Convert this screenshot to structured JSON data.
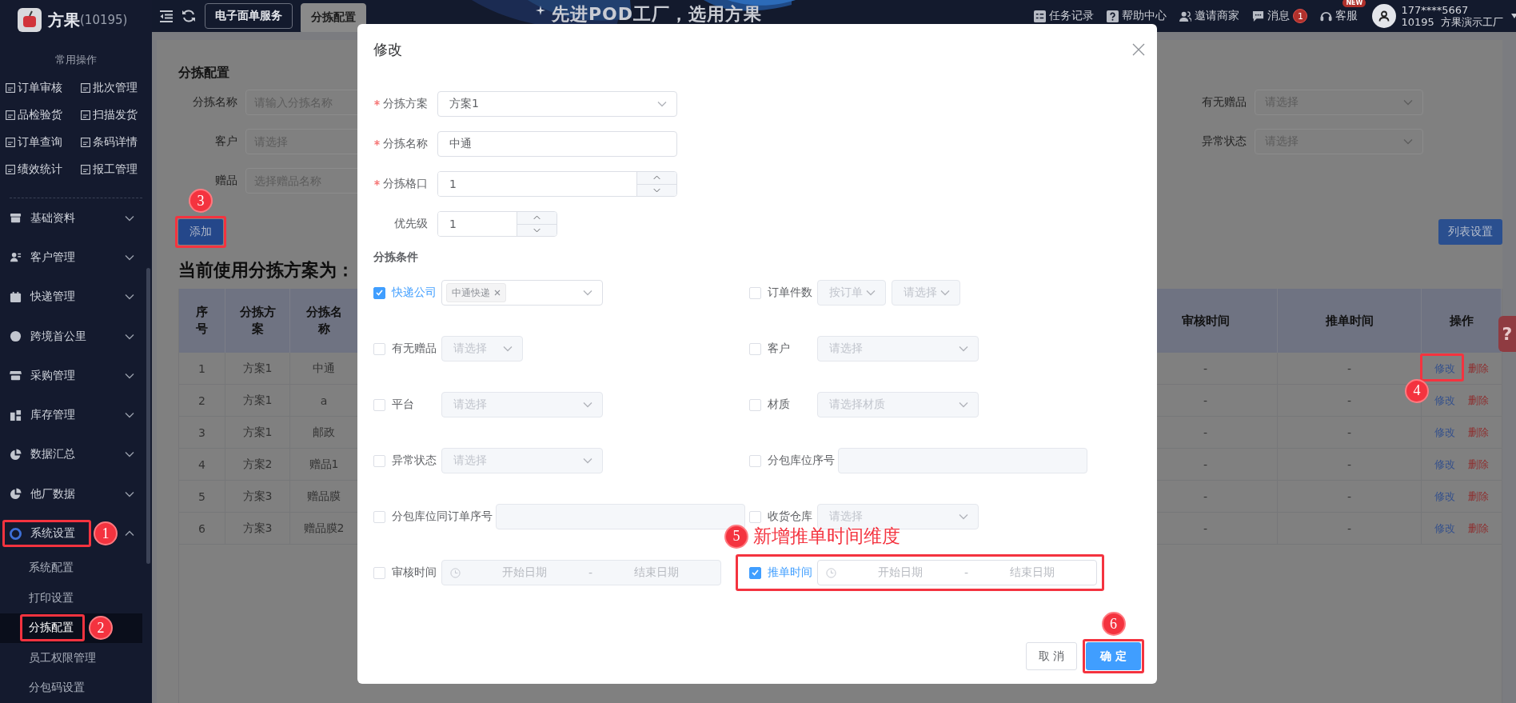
{
  "sidebar": {
    "logo_text": "方果",
    "logo_count": "(10195)",
    "quick_title": "常用操作",
    "quick_actions": [
      {
        "label": "订单审核"
      },
      {
        "label": "批次管理"
      },
      {
        "label": "品检验货"
      },
      {
        "label": "扫描发货"
      },
      {
        "label": "订单查询"
      },
      {
        "label": "条码详情"
      },
      {
        "label": "绩效统计"
      },
      {
        "label": "报工管理"
      }
    ],
    "menu": [
      {
        "label": "基础资料",
        "expanded": false
      },
      {
        "label": "客户管理",
        "expanded": false
      },
      {
        "label": "快递管理",
        "expanded": false
      },
      {
        "label": "跨境首公里",
        "expanded": false
      },
      {
        "label": "采购管理",
        "expanded": false
      },
      {
        "label": "库存管理",
        "expanded": false
      },
      {
        "label": "数据汇总",
        "expanded": false
      },
      {
        "label": "他厂数据",
        "expanded": false
      },
      {
        "label": "系统设置",
        "expanded": true,
        "callout": "1",
        "children": [
          {
            "label": "系统配置",
            "selected": false
          },
          {
            "label": "打印设置",
            "selected": false
          },
          {
            "label": "分拣配置",
            "selected": true,
            "callout": "2"
          },
          {
            "label": "员工权限管理",
            "selected": false
          },
          {
            "label": "分包码设置",
            "selected": false
          }
        ]
      }
    ]
  },
  "header": {
    "tabs": [
      {
        "label": "电子面单服务",
        "selected": false
      },
      {
        "label": "分拣配置",
        "selected": true
      }
    ],
    "banner": "先进POD工厂，选用方果",
    "links": [
      {
        "label": "任务记录"
      },
      {
        "label": "帮助中心"
      },
      {
        "label": "邀请商家"
      },
      {
        "label": "消息",
        "count": "1"
      },
      {
        "label": "客服",
        "badge": "NEW"
      }
    ],
    "user": {
      "phone": "177****5667",
      "company": "10195  方果演示工厂"
    }
  },
  "page": {
    "title": "分拣配置",
    "filters_left": [
      {
        "label": "分拣名称",
        "placeholder": "请输入分拣名称"
      },
      {
        "label": "客户",
        "placeholder": "请选择"
      },
      {
        "label": "赠品",
        "placeholder": "选择赠品名称"
      }
    ],
    "filters_right": [
      {
        "label": "有无赠品",
        "placeholder": "请选择"
      },
      {
        "label": "异常状态",
        "placeholder": "请选择"
      }
    ],
    "add_button": {
      "label": "添加",
      "callout": "3"
    },
    "list_settings_button": "列表设置",
    "heading": "当前使用分拣方案为：",
    "table": {
      "columns": [
        "序号",
        "分拣方案",
        "分拣名称",
        "审核时间",
        "推单时间",
        "操作"
      ],
      "rows": [
        {
          "cells": [
            "1",
            "方案1",
            "中通",
            "-",
            "-"
          ],
          "actions": [
            {
              "label": "修改",
              "kind": "edit",
              "callout": "4"
            },
            {
              "label": "删除",
              "kind": "delete"
            }
          ]
        },
        {
          "cells": [
            "2",
            "方案1",
            "a",
            "-",
            "-"
          ],
          "actions": [
            {
              "label": "修改",
              "kind": "edit"
            },
            {
              "label": "删除",
              "kind": "delete"
            }
          ]
        },
        {
          "cells": [
            "3",
            "方案1",
            "邮政",
            "-",
            "-"
          ],
          "actions": [
            {
              "label": "修改",
              "kind": "edit"
            },
            {
              "label": "删除",
              "kind": "delete"
            }
          ]
        },
        {
          "cells": [
            "4",
            "方案2",
            "赠品1",
            "-",
            "-"
          ],
          "actions": [
            {
              "label": "修改",
              "kind": "edit"
            },
            {
              "label": "删除",
              "kind": "delete"
            }
          ]
        },
        {
          "cells": [
            "5",
            "方案3",
            "赠品膜",
            "-",
            "-"
          ],
          "actions": [
            {
              "label": "修改",
              "kind": "edit"
            },
            {
              "label": "删除",
              "kind": "delete"
            }
          ]
        },
        {
          "cells": [
            "6",
            "方案3",
            "赠品膜2",
            "-",
            "-"
          ],
          "actions": [
            {
              "label": "修改",
              "kind": "edit"
            },
            {
              "label": "删除",
              "kind": "delete"
            }
          ]
        }
      ]
    },
    "help_tab": "?"
  },
  "modal": {
    "title": "修改",
    "fields": [
      {
        "label": "分拣方案",
        "required": true,
        "kind": "select",
        "value": "方案1"
      },
      {
        "label": "分拣名称",
        "required": true,
        "kind": "input",
        "value": "中通"
      },
      {
        "label": "分拣格口",
        "required": true,
        "kind": "number",
        "value": "1"
      },
      {
        "label": "优先级",
        "required": false,
        "kind": "number_short",
        "value": "1"
      }
    ],
    "conditions_title": "分拣条件",
    "conditions": [
      {
        "label": "快递公司",
        "checked": true,
        "kind": "tags",
        "tags": [
          "中通快递"
        ]
      },
      {
        "label": "订单件数",
        "checked": false,
        "kind": "selects",
        "selects": [
          {
            "placeholder": "按订单"
          },
          {
            "placeholder": "请选择"
          }
        ]
      },
      {
        "label": "有无赠品",
        "checked": false,
        "kind": "short_select",
        "placeholder": "请选择"
      },
      {
        "label": "客户",
        "checked": false,
        "kind": "select",
        "placeholder": "请选择"
      },
      {
        "label": "平台",
        "checked": false,
        "kind": "select",
        "placeholder": "请选择"
      },
      {
        "label": "材质",
        "checked": false,
        "kind": "select",
        "placeholder": "请选择材质"
      },
      {
        "label": "异常状态",
        "checked": false,
        "kind": "select",
        "placeholder": "请选择"
      },
      {
        "label": "分包库位序号",
        "checked": false,
        "kind": "input"
      },
      {
        "label": "分包库位同订单序号",
        "checked": false,
        "kind": "input"
      },
      {
        "label": "收货仓库",
        "checked": false,
        "kind": "select",
        "placeholder": "请选择"
      },
      {
        "label": "审核时间",
        "checked": false,
        "kind": "date_range",
        "start_placeholder": "开始日期",
        "separator": "-",
        "end_placeholder": "结束日期"
      },
      {
        "label": "推单时间",
        "checked": true,
        "kind": "date_range",
        "start_placeholder": "开始日期",
        "separator": "-",
        "end_placeholder": "结束日期",
        "callout": "5",
        "callout_text": "新增推单时间维度"
      }
    ],
    "buttons": [
      {
        "label": "取 消",
        "kind": "secondary"
      },
      {
        "label": "确 定",
        "kind": "primary",
        "callout": "6"
      }
    ]
  }
}
